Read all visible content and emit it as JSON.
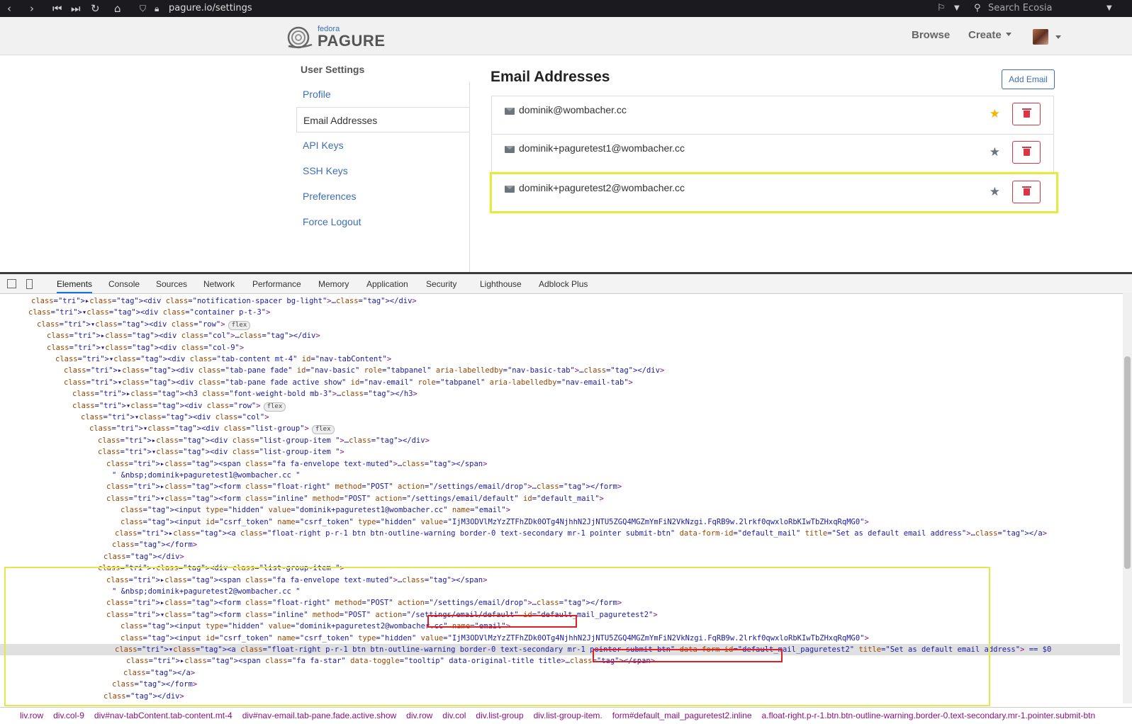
{
  "browser": {
    "url": "pagure.io/settings",
    "search_placeholder": "Search Ecosia"
  },
  "header": {
    "logo_small": "fedora",
    "logo_big": "PAGURE",
    "nav": [
      "Browse",
      "Create"
    ]
  },
  "sidebar": {
    "title": "User Settings",
    "items": [
      "Profile",
      "Email Addresses",
      "API Keys",
      "SSH Keys",
      "Preferences",
      "Force Logout"
    ],
    "active_index": 1
  },
  "main": {
    "title": "Email Addresses",
    "add_button": "Add Email",
    "emails": [
      {
        "address": "dominik@wombacher.cc",
        "default": true
      },
      {
        "address": "dominik+paguretest1@wombacher.cc",
        "default": false
      },
      {
        "address": "dominik+paguretest2@wombacher.cc",
        "default": false
      }
    ]
  },
  "devtools": {
    "tabs": [
      "Elements",
      "Console",
      "Sources",
      "Network",
      "Performance",
      "Memory",
      "Application",
      "Security",
      "Lighthouse",
      "Adblock Plus"
    ],
    "active_tab": "Elements",
    "breadcrumbs": [
      "liv.row",
      "div.col-9",
      "div#nav-tabContent.tab-content.mt-4",
      "div#nav-email.tab-pane.fade.active.show",
      "div.row",
      "div.col",
      "div.list-group",
      "div.list-group-item.",
      "form#default_mail_paguretest2.inline",
      "a.float-right.p-r-1.btn.btn-outline-warning.border-0.text-secondary.mr-1.pointer.submit-btn"
    ],
    "dom_lines": [
      {
        "indent": 44,
        "html": "▸<div class=\"notification-spacer bg-light\">…</div>"
      },
      {
        "indent": 40,
        "html": "▾<div class=\"container p-t-3\">"
      },
      {
        "indent": 52,
        "html": "▾<div class=\"row\">",
        "badge": "flex"
      },
      {
        "indent": 66,
        "html": "▸<div class=\"col\">…</div>"
      },
      {
        "indent": 66,
        "html": "▾<div class=\"col-9\">"
      },
      {
        "indent": 78,
        "html": "▾<div class=\"tab-content mt-4\" id=\"nav-tabContent\">"
      },
      {
        "indent": 90,
        "html": "▸<div class=\"tab-pane fade\" id=\"nav-basic\" role=\"tabpanel\" aria-labelledby=\"nav-basic-tab\">…</div>"
      },
      {
        "indent": 90,
        "html": "▾<div class=\"tab-pane fade active show\" id=\"nav-email\" role=\"tabpanel\" aria-labelledby=\"nav-email-tab\">"
      },
      {
        "indent": 102,
        "html": "▸<h3 class=\"font-weight-bold mb-3\">…</h3>"
      },
      {
        "indent": 102,
        "html": "▾<div class=\"row\">",
        "badge": "flex"
      },
      {
        "indent": 114,
        "html": "▾<div class=\"col\">"
      },
      {
        "indent": 126,
        "html": "▾<div class=\"list-group\">",
        "badge": "flex"
      },
      {
        "indent": 138,
        "html": "▸<div class=\"list-group-item \">…</div>"
      },
      {
        "indent": 138,
        "html": "▾<div class=\"list-group-item \">"
      },
      {
        "indent": 150,
        "html": "▸<span class=\"fa fa-envelope text-muted\">…</span>"
      },
      {
        "indent": 158,
        "html": "\" &nbsp;dominik+paguretest1@wombacher.cc \""
      },
      {
        "indent": 150,
        "html": "▸<form class=\"float-right\" method=\"POST\" action=\"/settings/email/drop\">…</form>"
      },
      {
        "indent": 150,
        "html": "▾<form class=\"inline\" method=\"POST\" action=\"/settings/email/default\" id=\"default_mail\">"
      },
      {
        "indent": 170,
        "html": "<input type=\"hidden\" value=\"dominik+paguretest1@wombacher.cc\" name=\"email\">"
      },
      {
        "indent": 170,
        "html": "<input id=\"csrf_token\" name=\"csrf_token\" type=\"hidden\" value=\"IjM3ODVlMzYzZTFhZDk0OTg4NjhhN2JjNTU5ZGQ4MGZmYmFiN2VkNzgi.FqRB9w.2lrkf0qwxloRbKIwTbZHxqRqMG0\">"
      },
      {
        "indent": 162,
        "html": "▸<a class=\"float-right p-r-1 btn btn-outline-warning border-0 text-secondary mr-1 pointer submit-btn\" data-form-id=\"default_mail\" title=\"Set as default email address\">…</a>"
      },
      {
        "indent": 158,
        "html": "</form>"
      },
      {
        "indent": 146,
        "html": "</div>"
      },
      {
        "indent": 138,
        "html": "▾<div class=\"list-group-item \">"
      },
      {
        "indent": 150,
        "html": "▸<span class=\"fa fa-envelope text-muted\">…</span>"
      },
      {
        "indent": 158,
        "html": "\" &nbsp;dominik+paguretest2@wombacher.cc \""
      },
      {
        "indent": 150,
        "html": "▸<form class=\"float-right\" method=\"POST\" action=\"/settings/email/drop\">…</form>"
      },
      {
        "indent": 150,
        "html": "▾<form class=\"inline\" method=\"POST\" action=\"/settings/email/default\" id=\"default_mail_paguretest2\">"
      },
      {
        "indent": 170,
        "html": "<input type=\"hidden\" value=\"dominik+paguretest2@wombacher.cc\" name=\"email\">"
      },
      {
        "indent": 170,
        "html": "<input id=\"csrf_token\" name=\"csrf_token\" type=\"hidden\" value=\"IjM3ODVlMzYzZTFhZDk0OTg4NjhhN2JjNTU5ZGQ4MGZmYmFiN2VkNzgi.FqRB9w.2lrkf0qwxloRbKIwTbZHxqRqMG0\">"
      },
      {
        "indent": 162,
        "html": "▾<a class=\"float-right p-r-1 btn btn-outline-warning border-0 text-secondary mr-1 pointer submit-btn\" data-form-id=\"default_mail_paguretest2\" title=\"Set as default email address\"> == $0",
        "selected": true
      },
      {
        "indent": 178,
        "html": "▸<span class=\"fa fa-star\" data-toggle=\"tooltip\" data-original-title title>…</span>"
      },
      {
        "indent": 174,
        "html": "</a>"
      },
      {
        "indent": 158,
        "html": "</form>"
      },
      {
        "indent": 146,
        "html": "</div>"
      }
    ],
    "colors": {
      "highlight": "#e5e84a",
      "annotation": "#e02020"
    }
  }
}
